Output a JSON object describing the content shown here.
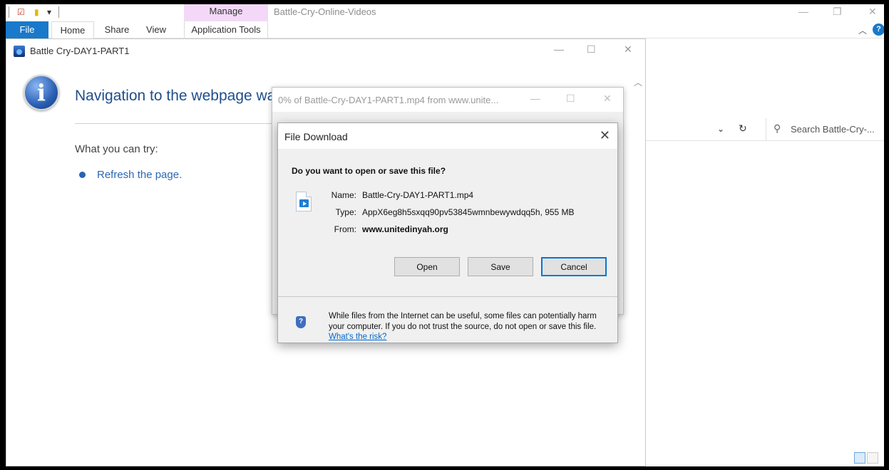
{
  "explorer": {
    "title": "Battle-Cry-Online-Videos",
    "manage_label": "Manage",
    "tabs": {
      "file": "File",
      "home": "Home",
      "share": "Share",
      "view": "View",
      "app_tools": "Application Tools"
    },
    "search_placeholder": "Search Battle-Cry-..."
  },
  "browser": {
    "title": "Battle Cry-DAY1-PART1",
    "message": "Navigation to the webpage wa",
    "try_label": "What you can try:",
    "refresh_link": "Refresh the page."
  },
  "progress_window": {
    "title": "0% of Battle-Cry-DAY1-PART1.mp4 from www.unite..."
  },
  "dialog": {
    "title": "File Download",
    "question": "Do you want to open or save this file?",
    "name_label": "Name:",
    "name_value": "Battle-Cry-DAY1-PART1.mp4",
    "type_label": "Type:",
    "type_value": "AppX6eg8h5sxqq90pv53845wmnbewywdqq5h, 955 MB",
    "from_label": "From:",
    "from_value": "www.unitedinyah.org",
    "buttons": {
      "open": "Open",
      "save": "Save",
      "cancel": "Cancel"
    },
    "warning_text": "While files from the Internet can be useful, some files can potentially harm your computer. If you do not trust the source, do not open or save this file.",
    "risk_link": "What's the risk?"
  },
  "colors": {
    "file_tab": "#1979ca",
    "manage_tab": "#f3d9f7",
    "link": "#0066cc",
    "heading": "#1f4e8c"
  }
}
